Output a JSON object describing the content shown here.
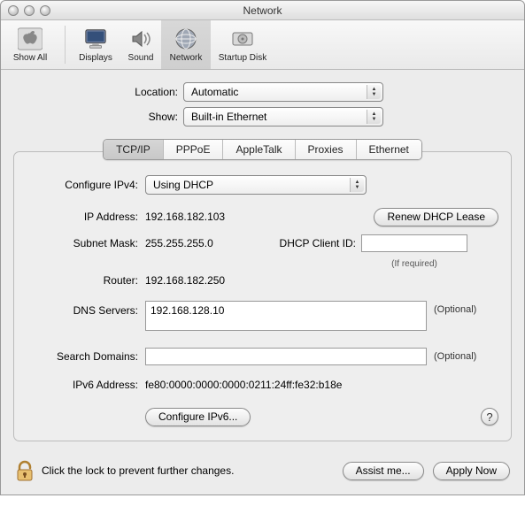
{
  "window": {
    "title": "Network"
  },
  "toolbar": {
    "items": [
      {
        "label": "Show All"
      },
      {
        "label": "Displays"
      },
      {
        "label": "Sound"
      },
      {
        "label": "Network"
      },
      {
        "label": "Startup Disk"
      }
    ]
  },
  "location": {
    "label": "Location:",
    "value": "Automatic"
  },
  "show": {
    "label": "Show:",
    "value": "Built-in Ethernet"
  },
  "tabs": [
    "TCP/IP",
    "PPPoE",
    "AppleTalk",
    "Proxies",
    "Ethernet"
  ],
  "tcpip": {
    "configure_label": "Configure IPv4:",
    "configure_value": "Using DHCP",
    "ip_label": "IP Address:",
    "ip_value": "192.168.182.103",
    "renew_label": "Renew DHCP Lease",
    "subnet_label": "Subnet Mask:",
    "subnet_value": "255.255.255.0",
    "client_id_label": "DHCP Client ID:",
    "client_id_value": "",
    "client_id_hint": "(If required)",
    "router_label": "Router:",
    "router_value": "192.168.182.250",
    "dns_label": "DNS Servers:",
    "dns_value": "192.168.128.10",
    "search_label": "Search Domains:",
    "search_value": "",
    "optional": "(Optional)",
    "ipv6_addr_label": "IPv6 Address:",
    "ipv6_addr_value": "fe80:0000:0000:0000:0211:24ff:fe32:b18e",
    "configure_ipv6_label": "Configure IPv6...",
    "help_label": "?"
  },
  "footer": {
    "lock_text": "Click the lock to prevent further changes.",
    "assist_label": "Assist me...",
    "apply_label": "Apply Now"
  }
}
